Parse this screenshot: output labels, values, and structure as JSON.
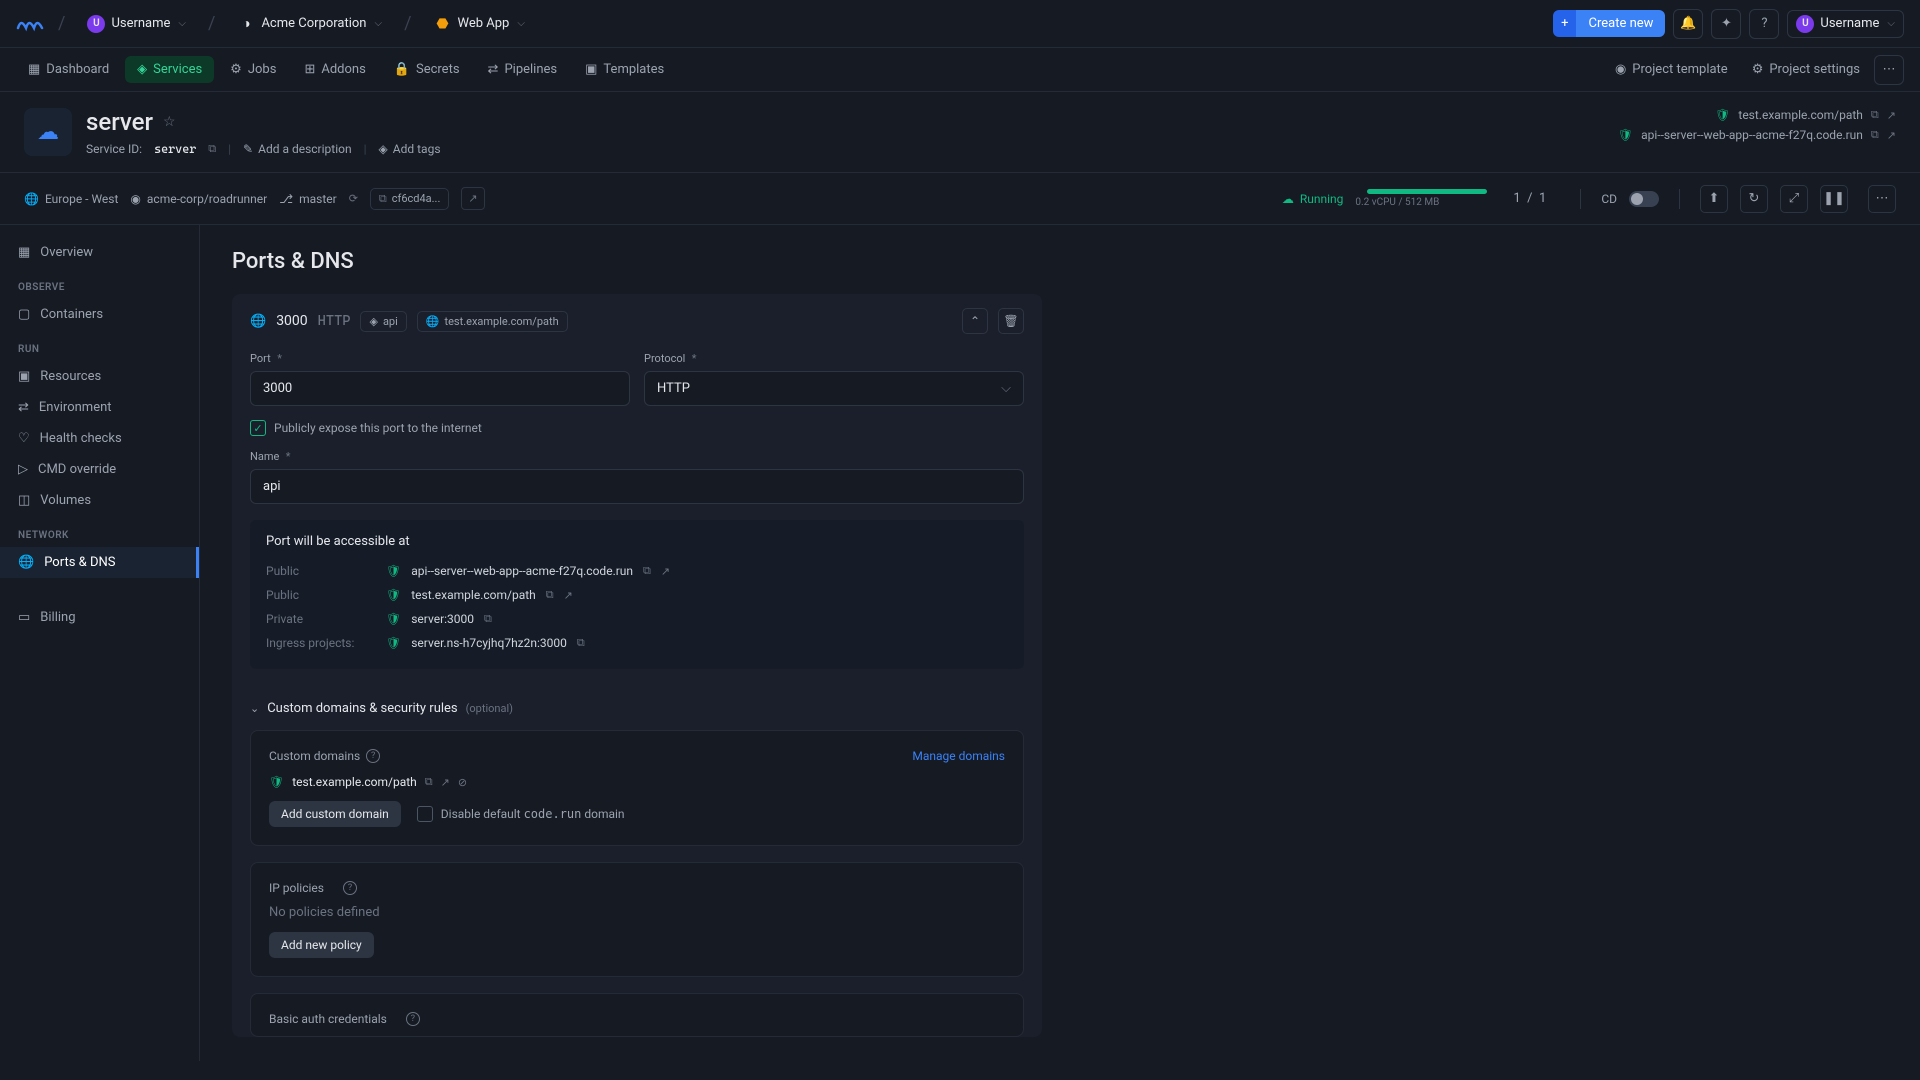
{
  "topbar": {
    "username": "Username",
    "user_initial": "U",
    "org": "Acme Corporation",
    "app": "Web App",
    "create_new": "Create new"
  },
  "nav": {
    "dashboard": "Dashboard",
    "services": "Services",
    "jobs": "Jobs",
    "addons": "Addons",
    "secrets": "Secrets",
    "pipelines": "Pipelines",
    "templates": "Templates",
    "project_template": "Project template",
    "project_settings": "Project settings"
  },
  "header": {
    "service_name": "server",
    "service_id_label": "Service ID:",
    "service_id": "server",
    "add_desc": "Add a description",
    "add_tags": "Add tags",
    "url1": "test.example.com/path",
    "url2": "api--server--web-app--acme-f27q.code.run"
  },
  "status": {
    "region": "Europe - West",
    "repo": "acme-corp/roadrunner",
    "branch": "master",
    "commit": "cf6cd4a...",
    "state": "Running",
    "resource": "0.2 vCPU / 512 MB",
    "replicas_cur": "1",
    "replicas_sep": "/",
    "replicas_tot": "1",
    "cd": "CD"
  },
  "sidebar": {
    "overview": "Overview",
    "h_observe": "OBSERVE",
    "containers": "Containers",
    "h_run": "RUN",
    "resources": "Resources",
    "environment": "Environment",
    "health": "Health checks",
    "cmd": "CMD override",
    "volumes": "Volumes",
    "h_network": "NETWORK",
    "ports": "Ports & DNS",
    "billing": "Billing"
  },
  "page": {
    "title": "Ports & DNS"
  },
  "port": {
    "number": "3000",
    "protocol": "HTTP",
    "tag_api": "api",
    "tag_domain": "test.example.com/path",
    "label_port": "Port",
    "label_protocol": "Protocol",
    "input_port": "3000",
    "select_protocol": "HTTP",
    "expose_label": "Publicly expose this port to the internet",
    "label_name": "Name",
    "input_name": "api",
    "req": "*"
  },
  "access": {
    "title": "Port will be accessible at",
    "public": "Public",
    "private": "Private",
    "ingress": "Ingress projects:",
    "url1": "api--server--web-app--acme-f27q.code.run",
    "url2": "test.example.com/path",
    "url3": "server:3000",
    "url4": "server.ns-h7cyjhq7hz2n:3000"
  },
  "custom": {
    "header": "Custom domains & security rules",
    "optional": "(optional)",
    "domains_title": "Custom domains",
    "manage": "Manage domains",
    "domain1": "test.example.com/path",
    "add_domain": "Add custom domain",
    "disable_default_pre": "Disable default ",
    "disable_default_code": "code.run",
    "disable_default_post": " domain",
    "ip_title": "IP policies",
    "ip_empty": "No policies defined",
    "add_policy": "Add new policy",
    "basic_auth_title": "Basic auth credentials"
  }
}
